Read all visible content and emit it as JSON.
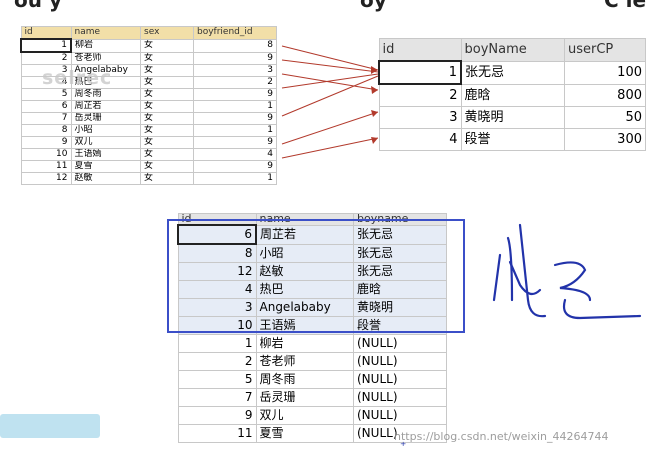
{
  "top_cut_text": [
    "ou y",
    "oy",
    "C le"
  ],
  "watermark_left": "selrec",
  "watermark_br": "https://blog.csdn.net/weixin_44264744",
  "table_girls": {
    "headers": [
      "id",
      "name",
      "sex",
      "boyfriend_id"
    ],
    "rows": [
      [
        "1",
        "柳岩",
        "女",
        "8"
      ],
      [
        "2",
        "苍老师",
        "女",
        "9"
      ],
      [
        "3",
        "Angelababy",
        "女",
        "3"
      ],
      [
        "4",
        "热巴",
        "女",
        "2"
      ],
      [
        "5",
        "周冬雨",
        "女",
        "9"
      ],
      [
        "6",
        "周芷若",
        "女",
        "1"
      ],
      [
        "7",
        "岳灵珊",
        "女",
        "9"
      ],
      [
        "8",
        "小昭",
        "女",
        "1"
      ],
      [
        "9",
        "双儿",
        "女",
        "9"
      ],
      [
        "10",
        "王语嫣",
        "女",
        "4"
      ],
      [
        "11",
        "夏雪",
        "女",
        "9"
      ],
      [
        "12",
        "赵敏",
        "女",
        "1"
      ]
    ]
  },
  "table_boys": {
    "headers": [
      "id",
      "boyName",
      "userCP"
    ],
    "rows": [
      [
        "1",
        "张无忌",
        "100"
      ],
      [
        "2",
        "鹿晗",
        "800"
      ],
      [
        "3",
        "黄晓明",
        "50"
      ],
      [
        "4",
        "段誉",
        "300"
      ]
    ]
  },
  "table_result": {
    "headers": [
      "id",
      "name",
      "boyname"
    ],
    "rows": [
      [
        "6",
        "周芷若",
        "张无忌"
      ],
      [
        "8",
        "小昭",
        "张无忌"
      ],
      [
        "12",
        "赵敏",
        "张无忌"
      ],
      [
        "4",
        "热巴",
        "鹿晗"
      ],
      [
        "3",
        "Angelababy",
        "黄晓明"
      ],
      [
        "10",
        "王语嫣",
        "段誉"
      ],
      [
        "1",
        "柳岩",
        "(NULL)"
      ],
      [
        "2",
        "苍老师",
        "(NULL)"
      ],
      [
        "5",
        "周冬雨",
        "(NULL)"
      ],
      [
        "7",
        "岳灵珊",
        "(NULL)"
      ],
      [
        "9",
        "双儿",
        "(NULL)"
      ],
      [
        "11",
        "夏雪",
        "(NULL)"
      ]
    ]
  },
  "colors": {
    "arrow": "#b23a2c",
    "highlight_box": "#3b4fc8",
    "ink": "#2233aa"
  }
}
